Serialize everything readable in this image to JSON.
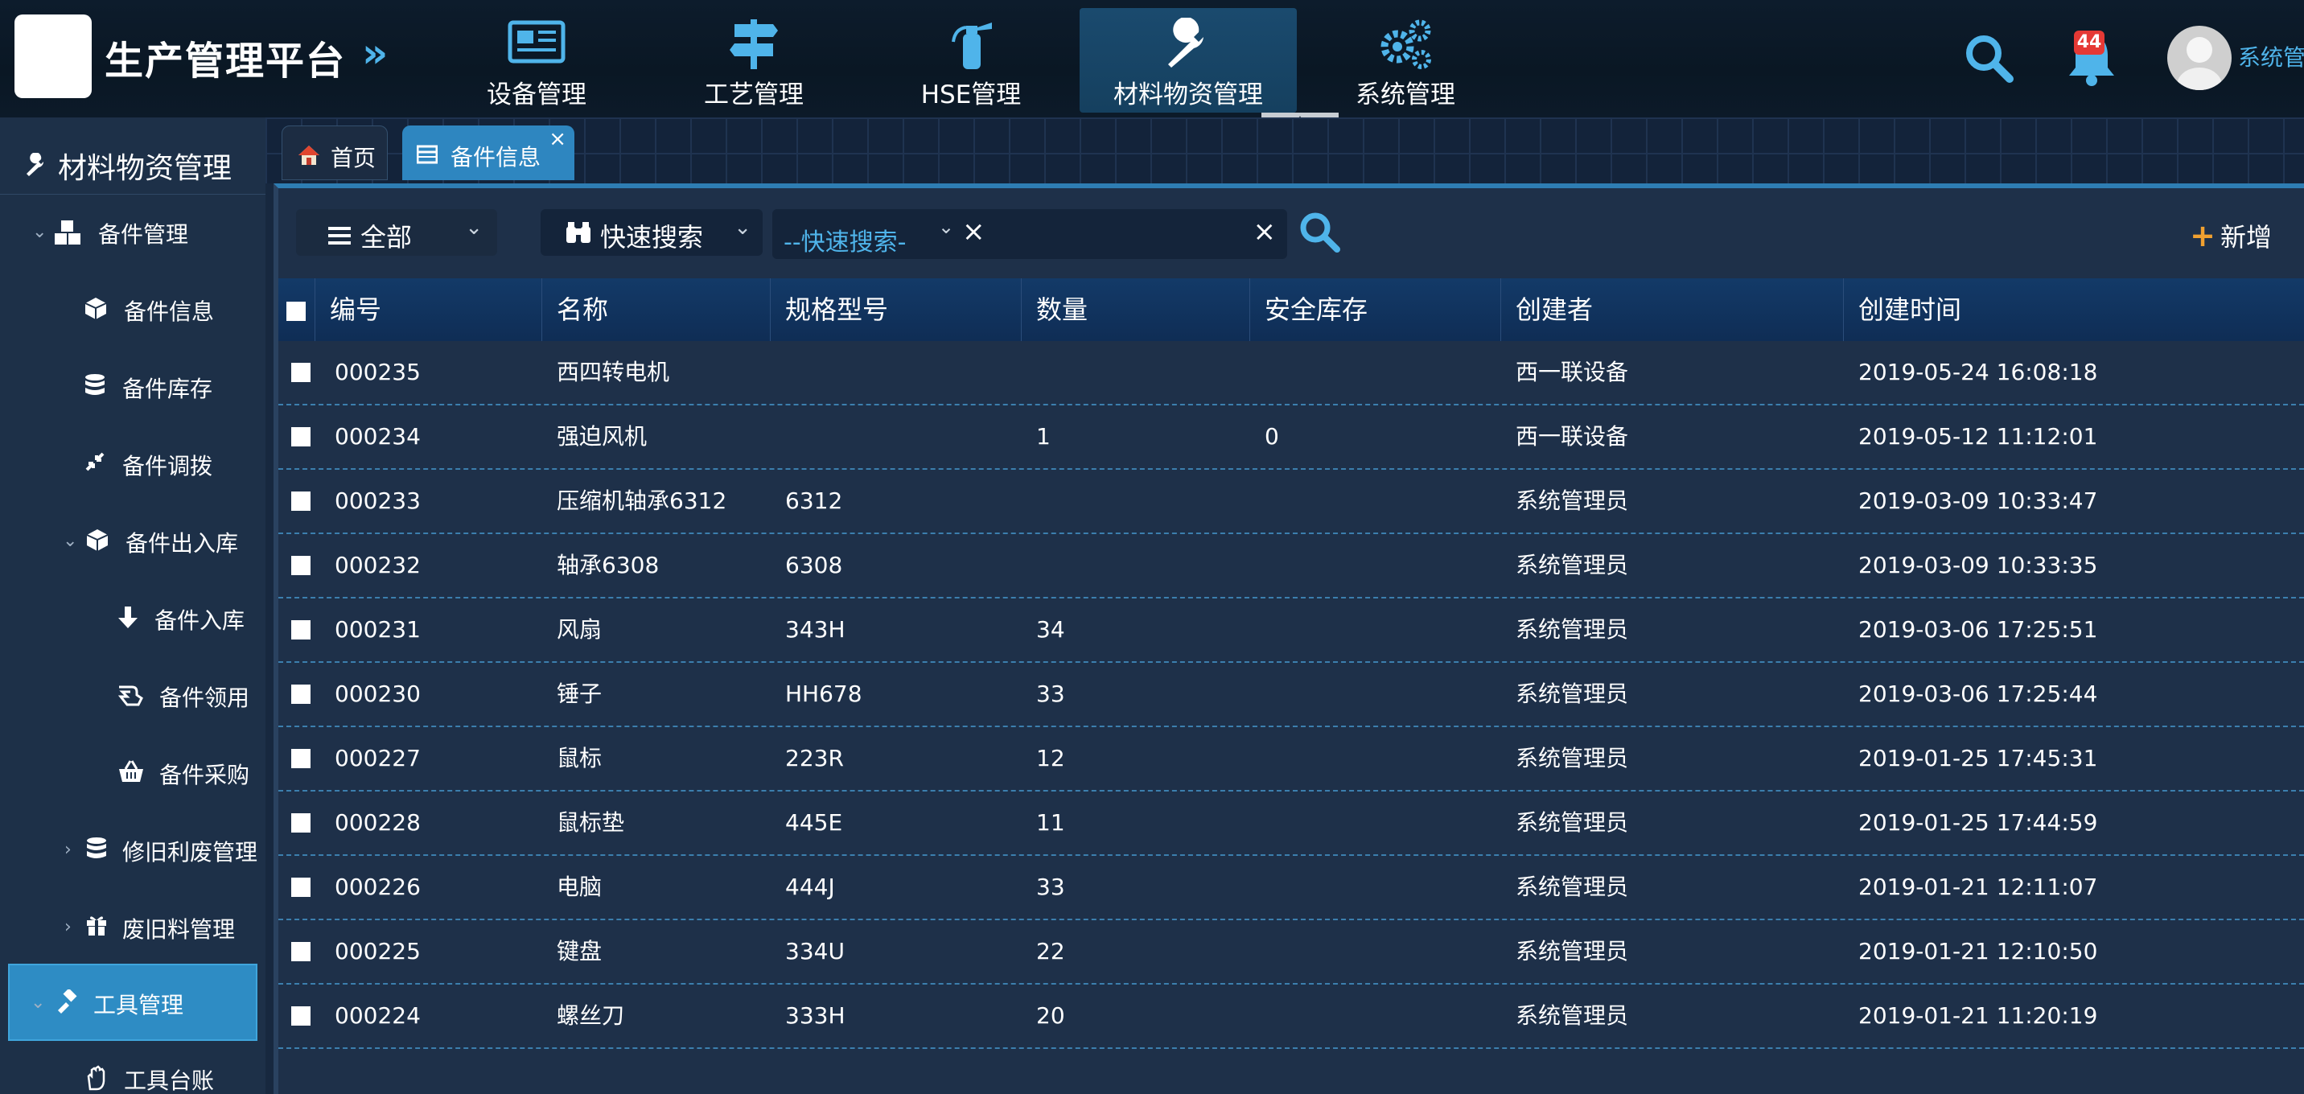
{
  "app": {
    "title": "生产管理平台",
    "user_name": "系统管理员",
    "notification_count": "44"
  },
  "top_nav": [
    {
      "label": "设备管理",
      "icon": "newspaper-icon",
      "active": false
    },
    {
      "label": "工艺管理",
      "icon": "signpost-icon",
      "active": false
    },
    {
      "label": "HSE管理",
      "icon": "fire-extinguisher-icon",
      "active": false
    },
    {
      "label": "材料物资管理",
      "icon": "wrench-icon",
      "active": true
    },
    {
      "label": "系统管理",
      "icon": "gears-icon",
      "active": false
    }
  ],
  "sidebar": {
    "title": "材料物资管理",
    "items": [
      {
        "label": "备件管理",
        "icon": "cubes-icon",
        "level": 1,
        "expanded": true
      },
      {
        "label": "备件信息",
        "icon": "cube-icon",
        "level": 2
      },
      {
        "label": "备件库存",
        "icon": "database-icon",
        "level": 2
      },
      {
        "label": "备件调拨",
        "icon": "compress-icon",
        "level": 2
      },
      {
        "label": "备件出入库",
        "icon": "cube-icon",
        "level": 2,
        "expanded": true
      },
      {
        "label": "备件入库",
        "icon": "arrow-down-icon",
        "level": 3
      },
      {
        "label": "备件领用",
        "icon": "hand-icon",
        "level": 3
      },
      {
        "label": "备件采购",
        "icon": "basket-icon",
        "level": 3
      },
      {
        "label": "修旧利废管理",
        "icon": "database-icon",
        "level": 2,
        "expanded": false
      },
      {
        "label": "废旧料管理",
        "icon": "gift-icon",
        "level": 2,
        "expanded": false
      },
      {
        "label": "工具管理",
        "icon": "gavel-icon",
        "level": 1,
        "expanded": true,
        "active": true
      },
      {
        "label": "工具台账",
        "icon": "hand-paper-icon",
        "level": 2
      }
    ]
  },
  "tabs": [
    {
      "label": "首页",
      "icon": "home-icon"
    },
    {
      "label": "备件信息",
      "icon": "table-icon",
      "closable": true,
      "active": true
    }
  ],
  "toolbar": {
    "filter_select": "全部",
    "quick_search_select": "快速搜索",
    "quick_search_placeholder": "--快速搜索-",
    "add_label": "新增"
  },
  "table": {
    "columns": [
      "编号",
      "名称",
      "规格型号",
      "数量",
      "安全库存",
      "创建者",
      "创建时间"
    ],
    "rows": [
      [
        "000235",
        "西四转电机",
        "",
        "",
        "",
        "西一联设备",
        "2019-05-24 16:08:18"
      ],
      [
        "000234",
        "强迫风机",
        "",
        "1",
        "0",
        "西一联设备",
        "2019-05-12 11:12:01"
      ],
      [
        "000233",
        "压缩机轴承6312",
        "6312",
        "",
        "",
        "系统管理员",
        "2019-03-09 10:33:47"
      ],
      [
        "000232",
        "轴承6308",
        "6308",
        "",
        "",
        "系统管理员",
        "2019-03-09 10:33:35"
      ],
      [
        "000231",
        "风扇",
        "343H",
        "34",
        "",
        "系统管理员",
        "2019-03-06 17:25:51"
      ],
      [
        "000230",
        "锤子",
        "HH678",
        "33",
        "",
        "系统管理员",
        "2019-03-06 17:25:44"
      ],
      [
        "000227",
        "鼠标",
        "223R",
        "12",
        "",
        "系统管理员",
        "2019-01-25 17:45:31"
      ],
      [
        "000228",
        "鼠标垫",
        "445E",
        "11",
        "",
        "系统管理员",
        "2019-01-25 17:44:59"
      ],
      [
        "000226",
        "电脑",
        "444J",
        "33",
        "",
        "系统管理员",
        "2019-01-21 12:11:07"
      ],
      [
        "000225",
        "键盘",
        "334U",
        "22",
        "",
        "系统管理员",
        "2019-01-21 12:10:50"
      ],
      [
        "000224",
        "螺丝刀",
        "333H",
        "20",
        "",
        "系统管理员",
        "2019-01-21 11:20:19"
      ]
    ]
  },
  "colors": {
    "accent": "#2e86c0",
    "header_bg": "#0d1c2c",
    "panel_bg": "#1e3049",
    "icon_blue": "#4fb4ea",
    "add_orange": "#f0a030",
    "badge_red": "#e53935"
  }
}
